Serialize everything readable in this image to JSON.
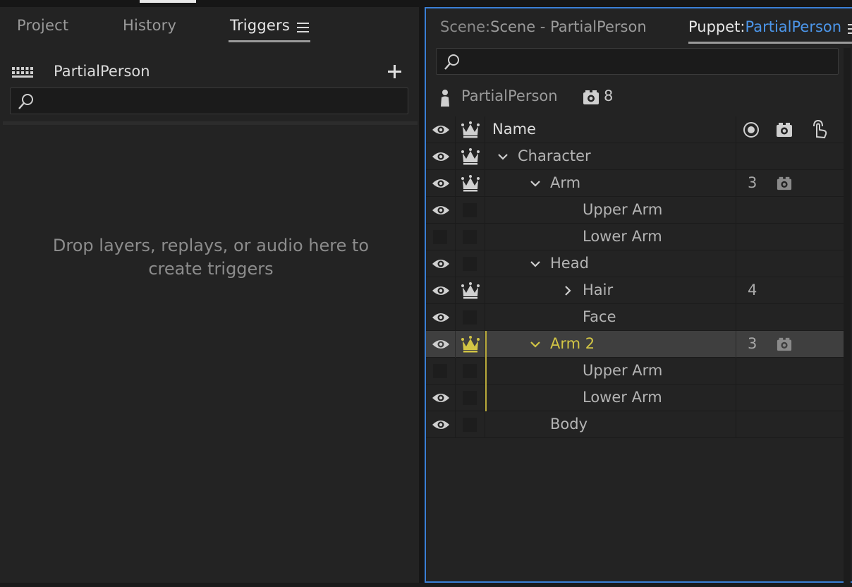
{
  "left_panel": {
    "tabs": [
      {
        "label": "Project"
      },
      {
        "label": "History"
      },
      {
        "label": "Triggers"
      }
    ],
    "trigger_set_name": "PartialPerson",
    "search": {
      "placeholder": ""
    },
    "drop_message": [
      "Drop layers, replays, or audio here to",
      "create triggers"
    ]
  },
  "right_panel": {
    "tabs": [
      {
        "label": "Scene:",
        "value": "Scene - PartialPerson"
      },
      {
        "label": "Puppet:",
        "value": "PartialPerson"
      }
    ],
    "search": {
      "placeholder": ""
    },
    "puppet_name": "PartialPerson",
    "camera_count": "8",
    "table": {
      "header": {
        "name": "Name"
      },
      "rows": [
        {
          "name": "Character",
          "depth": 0,
          "expanded": true,
          "eye": true,
          "crown": true,
          "count": "",
          "camera": false,
          "selected": false
        },
        {
          "name": "Arm",
          "depth": 1,
          "expanded": true,
          "eye": true,
          "crown": true,
          "count": "3",
          "camera": true,
          "selected": false
        },
        {
          "name": "Upper Arm",
          "depth": 2,
          "expanded": null,
          "eye": true,
          "crown": false,
          "count": "",
          "camera": false,
          "selected": false
        },
        {
          "name": "Lower Arm",
          "depth": 2,
          "expanded": null,
          "eye": false,
          "crown": false,
          "count": "",
          "camera": false,
          "selected": false
        },
        {
          "name": "Head",
          "depth": 1,
          "expanded": true,
          "eye": true,
          "crown": false,
          "count": "",
          "camera": false,
          "selected": false
        },
        {
          "name": "Hair",
          "depth": 2,
          "expanded": false,
          "eye": true,
          "crown": true,
          "count": "4",
          "camera": false,
          "selected": false
        },
        {
          "name": "Face",
          "depth": 2,
          "expanded": null,
          "eye": true,
          "crown": false,
          "count": "",
          "camera": false,
          "selected": false
        },
        {
          "name": "Arm 2",
          "depth": 1,
          "expanded": true,
          "eye": true,
          "crown": true,
          "count": "3",
          "camera": true,
          "selected": true
        },
        {
          "name": "Upper Arm",
          "depth": 2,
          "expanded": null,
          "eye": false,
          "crown": false,
          "count": "",
          "camera": false,
          "selected": false,
          "in_selection": true
        },
        {
          "name": "Lower Arm",
          "depth": 2,
          "expanded": null,
          "eye": true,
          "crown": false,
          "count": "",
          "camera": false,
          "selected": false,
          "in_selection": true
        },
        {
          "name": "Body",
          "depth": 1,
          "expanded": null,
          "eye": true,
          "crown": false,
          "count": "",
          "camera": false,
          "selected": false
        }
      ]
    }
  },
  "colors": {
    "accent_blue": "#4c96ea",
    "focus_border": "#3a7fd6",
    "selection_yellow": "#d2c545",
    "panel_bg": "#232323"
  },
  "icons": [
    "hamburger-menu-icon",
    "grid-icon",
    "plus-icon",
    "search-icon",
    "person-icon",
    "camera-icon",
    "eye-icon",
    "crown-icon",
    "record-icon",
    "touch-icon",
    "chevron-down-icon",
    "chevron-right-icon"
  ]
}
